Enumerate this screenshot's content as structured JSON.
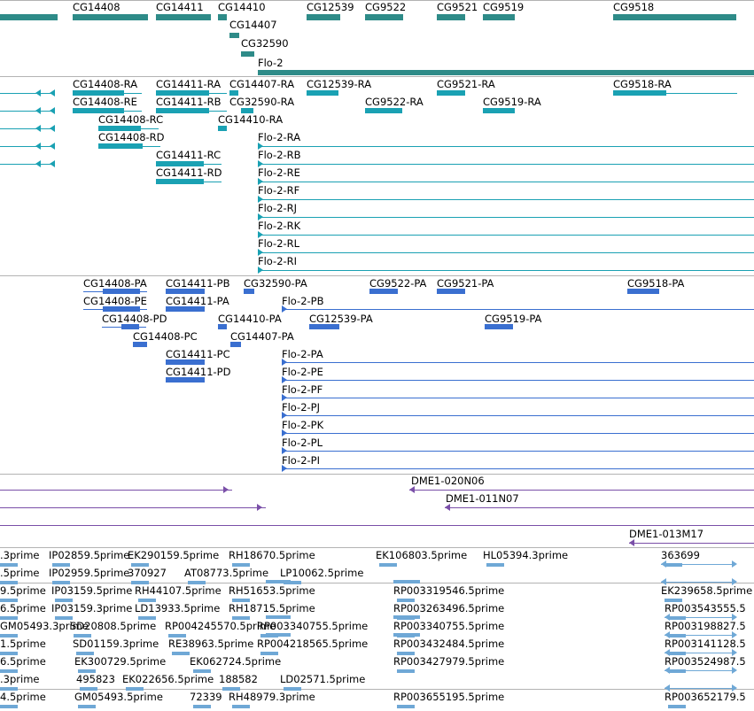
{
  "colors": {
    "gene": "#2e8b88",
    "transcript": "#1aa1b3",
    "protein": "#3a6fd0",
    "clone": "#7a4fa8",
    "est": "#6fa8d6",
    "separator": "#b3b3b3"
  },
  "tracks": {
    "genes": {
      "labels": [
        "CG14408",
        "CG14411",
        "CG14410",
        "CG14407",
        "CG32590",
        "CG12539",
        "CG9522",
        "CG9521",
        "CG9519",
        "CG9518",
        "Flo-2"
      ]
    },
    "transcripts": {
      "labels": [
        "CG14408-RA",
        "CG14411-RA",
        "CG14407-RA",
        "CG12539-RA",
        "CG9521-RA",
        "CG9518-RA",
        "CG14408-RE",
        "CG14411-RB",
        "CG32590-RA",
        "CG9522-RA",
        "CG9519-RA",
        "CG14408-RC",
        "CG14410-RA",
        "CG14408-RD",
        "Flo-2-RA",
        "CG14411-RC",
        "Flo-2-RB",
        "CG14411-RD",
        "Flo-2-RE",
        "Flo-2-RF",
        "Flo-2-RJ",
        "Flo-2-RK",
        "Flo-2-RL",
        "Flo-2-RI"
      ]
    },
    "proteins": {
      "labels": [
        "CG14408-PA",
        "CG14411-PB",
        "CG32590-PA",
        "CG9522-PA",
        "CG9521-PA",
        "CG9518-PA",
        "CG14408-PE",
        "CG14411-PA",
        "Flo-2-PB",
        "CG14408-PD",
        "CG14410-PA",
        "CG12539-PA",
        "CG9519-PA",
        "CG14408-PC",
        "CG14407-PA",
        "CG14411-PC",
        "Flo-2-PA",
        "CG14411-PD",
        "Flo-2-PE",
        "Flo-2-PF",
        "Flo-2-PJ",
        "Flo-2-PK",
        "Flo-2-PL",
        "Flo-2-PI"
      ]
    },
    "clones": {
      "labels": [
        "DME1-020N06",
        "DME1-011N07",
        "DME1-013M17"
      ]
    },
    "ests": {
      "labels": [
        ".3prime",
        "IP02859.5prime",
        "EK290159.5prime",
        "RH18670.5prime",
        "EK106803.5prime",
        "HL05394.3prime",
        "363699",
        ".5prime",
        "IP02959.5prime",
        "370927",
        "AT08773.5prime",
        "LP10062.5prime",
        "9.5prime",
        "IP03159.5prime",
        "RH44107.5prime",
        "RH51653.5prime",
        "RP003319546.5prime",
        "EK239658.5prime",
        "6.5prime",
        "IP03159.3prime",
        "LD13933.5prime",
        "RH18715.5prime",
        "RP003263496.5prime",
        "RP003543555.5",
        "GM05493.3prime",
        "SD20808.5prime",
        "RP004245570.5prime",
        "RP003340755.5prime",
        "RP003198827.5",
        "1.5prime",
        "SD01159.3prime",
        "RE38963.5prime",
        "RP004218565.5prime",
        "RP003432484.5prime",
        "RP003141128.5",
        "EK300729.5prime",
        "EK062724.5prime",
        "RP003427979.5prime",
        "RP003524987.5",
        ".3prime",
        "495823",
        "EK022656.5prime",
        "188582",
        "LD02571.5prime",
        "4.5prime",
        "GM05493.5prime",
        "72339",
        "RH48979.3prime",
        "RP003655195.5prime",
        "RP003652179.5"
      ]
    }
  }
}
